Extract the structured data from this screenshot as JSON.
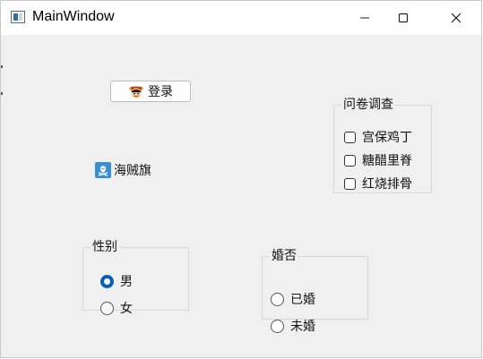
{
  "window": {
    "title": "MainWindow"
  },
  "login_button": {
    "label": "登录"
  },
  "flag_label": {
    "text": "海贼旗"
  },
  "survey": {
    "title": "问卷调查",
    "options": [
      {
        "label": "宫保鸡丁",
        "checked": false
      },
      {
        "label": "糖醋里脊",
        "checked": false
      },
      {
        "label": "红烧排骨",
        "checked": false
      }
    ]
  },
  "gender": {
    "title": "性别",
    "options": [
      {
        "label": "男",
        "checked": true
      },
      {
        "label": "女",
        "checked": false
      }
    ]
  },
  "married": {
    "title": "婚否",
    "options": [
      {
        "label": "已婚",
        "checked": false
      },
      {
        "label": "未婚",
        "checked": false
      }
    ]
  },
  "colors": {
    "accent": "#0a5fb4",
    "window_bg": "#f0f0f0",
    "titlebar_bg": "#ffffff"
  }
}
